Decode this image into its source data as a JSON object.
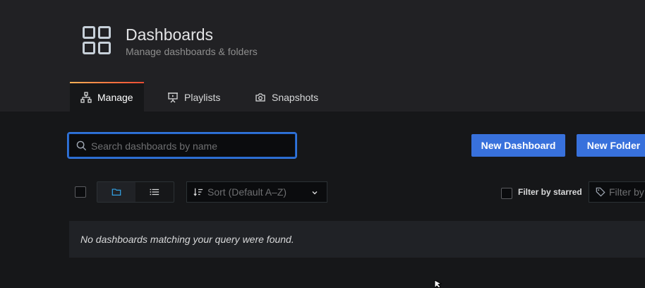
{
  "header": {
    "title": "Dashboards",
    "subtitle": "Manage dashboards & folders",
    "icon": "dashboards-grid-icon"
  },
  "tabs": [
    {
      "label": "Manage",
      "icon": "sitemap-icon",
      "active": true
    },
    {
      "label": "Playlists",
      "icon": "presentation-icon",
      "active": false
    },
    {
      "label": "Snapshots",
      "icon": "camera-icon",
      "active": false
    }
  ],
  "search": {
    "placeholder": "Search dashboards by name",
    "value": ""
  },
  "actions": {
    "new_dashboard": "New Dashboard",
    "new_folder": "New Folder"
  },
  "filters": {
    "sort_placeholder": "Sort (Default A–Z)",
    "starred_label": "Filter by starred",
    "tag_placeholder": "Filter by"
  },
  "view_modes": [
    "folder-view",
    "list-view"
  ],
  "empty_message": "No dashboards matching your query were found.",
  "colors": {
    "primary": "#3871dc",
    "accent_gradient": [
      "#ffb357",
      "#e74b33"
    ],
    "background": "#161719"
  }
}
